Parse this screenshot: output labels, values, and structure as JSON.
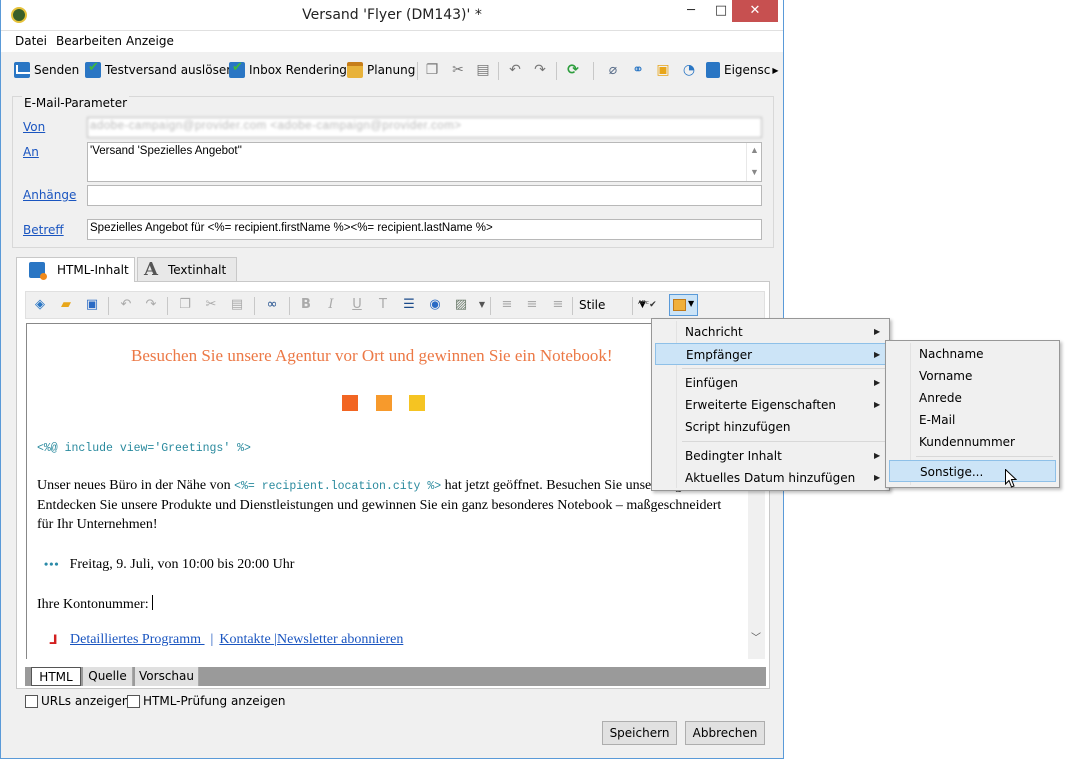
{
  "window": {
    "title": "Versand 'Flyer (DM143)' *",
    "min": "─",
    "max": "□",
    "close": "✕"
  },
  "menubar": [
    "Datei",
    "Bearbeiten",
    "Anzeige"
  ],
  "toolbar": {
    "send": "Senden",
    "proof": "Testversand auslösen",
    "inbox": "Inbox Rendering",
    "planning": "Planung",
    "properties": "Eigensc"
  },
  "email_params": {
    "title": "E-Mail-Parameter",
    "from_label": "Von",
    "from_value": "adobe-campaign@provider.com <adobe-campaign@provider.com>",
    "to_label": "An",
    "to_value": "'Versand 'Spezielles Angebot''",
    "attachments_label": "Anhänge",
    "attachments_value": "",
    "subject_label": "Betreff",
    "subject_value": "Spezielles Angebot für <%= recipient.firstName %><%= recipient.lastName %>"
  },
  "tabs": {
    "html": "HTML-Inhalt",
    "text": "Textinhalt"
  },
  "editor_toolbar": {
    "style_label": "Stile"
  },
  "content": {
    "promo": "Besuchen Sie unsere Agentur vor Ort und gewinnen Sie ein Notebook!",
    "squares": [
      "#f26522",
      "#f79a2c",
      "#f5c422"
    ],
    "include_code": "<%@ include view='Greetings' %>",
    "para_before": "Unser neues Büro in der Nähe von ",
    "para_tag": "<%= recipient.location.city %>",
    "para_after": " hat jetzt geöffnet. Besuchen Sie unsere Agentur. Entdecken Sie unsere Produkte und Dienstleistungen und gewinnen Sie ein ganz besonderes Notebook – maßgeschneidert für Ihr Unternehmen!",
    "bullet_dots": "•••",
    "bullet": "Freitag, 9. Juli, von 10:00 bis 20:00 Uhr",
    "account": "Ihre Kontonummer:",
    "pdf_icon": "⅃",
    "links": [
      "Detailliertes Programm ",
      "Kontakte ",
      "Newsletter abonnieren "
    ],
    "link_sep": "|"
  },
  "mode_tabs": [
    "HTML",
    "Quelle",
    "Vorschau"
  ],
  "checkboxes": {
    "urls": "URLs anzeigen",
    "html_check": "HTML-Prüfung anzeigen"
  },
  "buttons": {
    "save": "Speichern",
    "cancel": "Abbrechen"
  },
  "context_menu": {
    "items": [
      "Nachricht",
      "Empfänger",
      "Einfügen",
      "Erweiterte Eigenschaften",
      "Script hinzufügen",
      "Bedingter Inhalt",
      "Aktuelles Datum hinzufügen"
    ],
    "arrow": "▶"
  },
  "submenu": {
    "items": [
      "Nachname",
      "Vorname",
      "Anrede",
      "E-Mail",
      "Kundennummer",
      "Sonstige..."
    ]
  }
}
